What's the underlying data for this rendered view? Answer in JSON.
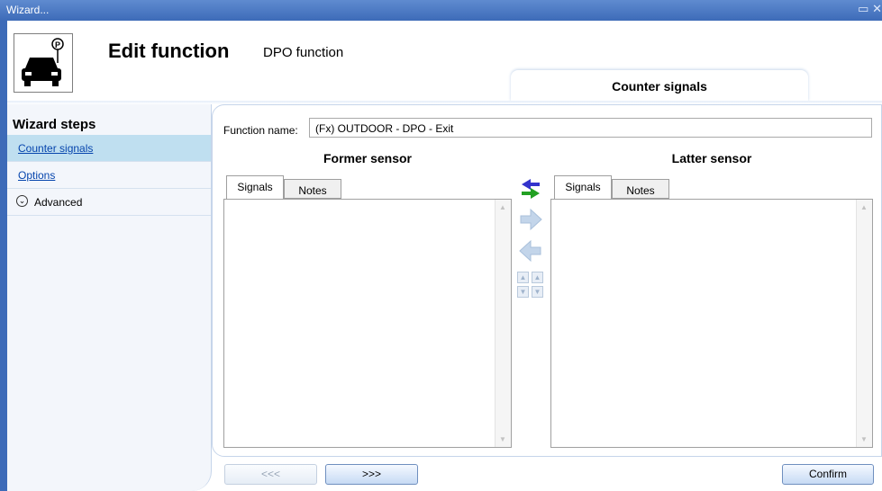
{
  "window": {
    "title": "Wizard..."
  },
  "header": {
    "title": "Edit function",
    "subtitle": "DPO function",
    "icon": "car-parking-icon",
    "active_tab": "Counter signals"
  },
  "sidebar": {
    "title": "Wizard steps",
    "items": [
      {
        "label": "Counter signals"
      },
      {
        "label": "Options"
      },
      {
        "label": "Advanced",
        "icon": "chevron-down-circle-icon"
      }
    ]
  },
  "form": {
    "function_name_label": "Function name:",
    "function_name_value": "(Fx) OUTDOOR - DPO - Exit"
  },
  "former": {
    "title": "Former sensor",
    "tabs": [
      "Signals",
      "Notes"
    ]
  },
  "latter": {
    "title": "Latter sensor",
    "tabs": [
      "Signals",
      "Notes"
    ]
  },
  "footer": {
    "prev_label": "<<<",
    "next_label": ">>>",
    "confirm_label": "Confirm"
  },
  "colors": {
    "titlebar": "#3d6bb8",
    "active_step": "#bfdff0",
    "link": "#0645ad"
  }
}
